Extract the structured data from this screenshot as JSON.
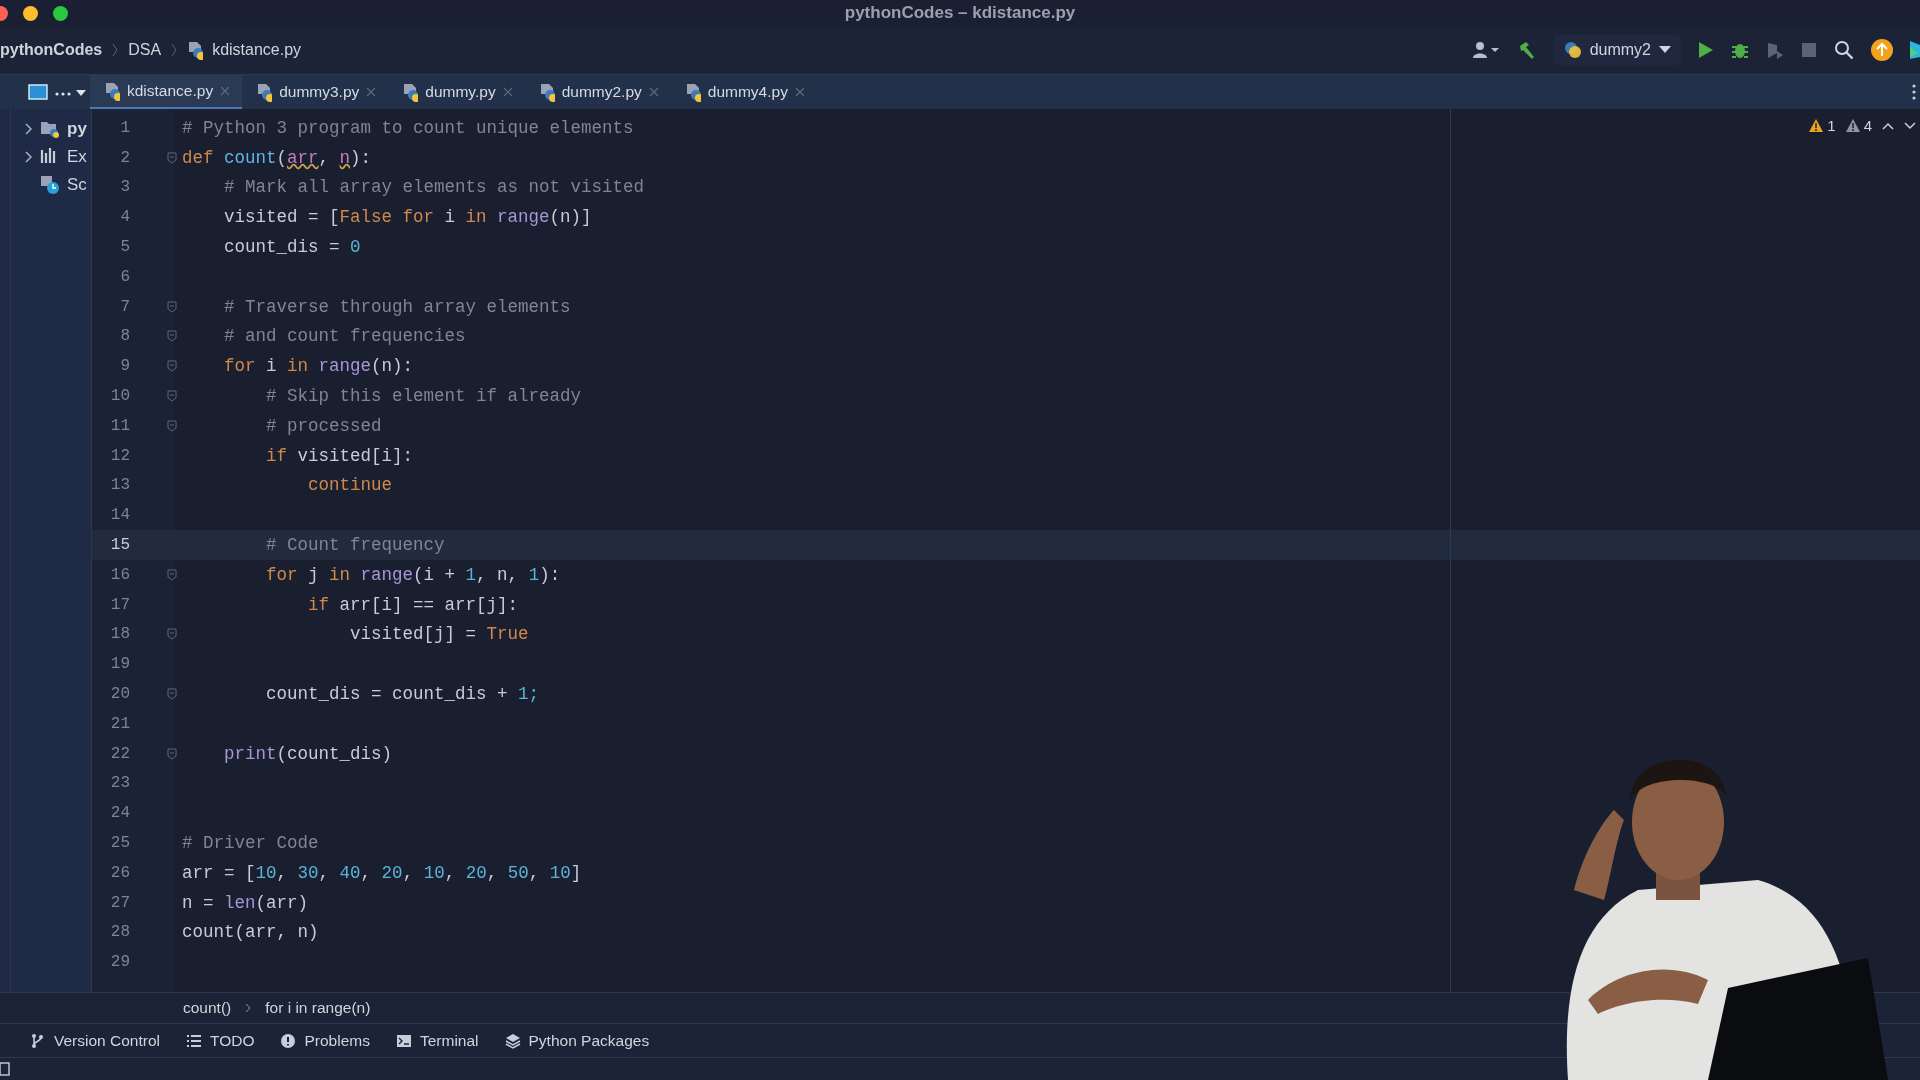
{
  "window": {
    "title": "pythonCodes – kdistance.py"
  },
  "navbar": {
    "crumbs": [
      "pythonCodes",
      "DSA",
      "kdistance.py"
    ],
    "run_config": "dummy2"
  },
  "tabs": [
    {
      "label": "kdistance.py",
      "selected": true
    },
    {
      "label": "dummy3.py",
      "selected": false
    },
    {
      "label": "dummy.py",
      "selected": false
    },
    {
      "label": "dummy2.py",
      "selected": false
    },
    {
      "label": "dummy4.py",
      "selected": false
    }
  ],
  "project_tree": [
    {
      "label": "py",
      "kind": "folder",
      "expanded": false
    },
    {
      "label": "Ex",
      "kind": "libs",
      "expanded": false
    },
    {
      "label": "Sc",
      "kind": "scratch"
    }
  ],
  "inspections": {
    "errors": "1",
    "warnings": "4"
  },
  "code": [
    {
      "n": "1",
      "fold": false,
      "current": false,
      "tokens": [
        {
          "kind": "cmt",
          "text": "# Python 3 program to count unique elements"
        }
      ]
    },
    {
      "n": "2",
      "fold": true,
      "current": false,
      "tokens": [
        {
          "kind": "kw",
          "text": "def "
        },
        {
          "kind": "fn",
          "text": "count"
        },
        {
          "kind": "p",
          "text": "("
        },
        {
          "kind": "warn",
          "text": "arr"
        },
        {
          "kind": "p",
          "text": ", "
        },
        {
          "kind": "warn",
          "text": "n"
        },
        {
          "kind": "p",
          "text": "):"
        }
      ]
    },
    {
      "n": "3",
      "fold": false,
      "current": false,
      "tokens": [
        {
          "kind": "cmt",
          "text": "    # Mark all array elements as not visited"
        }
      ]
    },
    {
      "n": "4",
      "fold": false,
      "current": false,
      "tokens": [
        {
          "kind": "p",
          "text": "    visited = ["
        },
        {
          "kind": "kw",
          "text": "False for "
        },
        {
          "kind": "p",
          "text": "i "
        },
        {
          "kind": "kw",
          "text": "in "
        },
        {
          "kind": "bi",
          "text": "range"
        },
        {
          "kind": "p",
          "text": "(n)]"
        }
      ]
    },
    {
      "n": "5",
      "fold": false,
      "current": false,
      "tokens": [
        {
          "kind": "p",
          "text": "    count_dis = "
        },
        {
          "kind": "num",
          "text": "0"
        }
      ]
    },
    {
      "n": "6",
      "fold": false,
      "current": false
    },
    {
      "n": "7",
      "fold": true,
      "current": false,
      "tokens": [
        {
          "kind": "cmt",
          "text": "    # Traverse through array elements"
        }
      ]
    },
    {
      "n": "8",
      "fold": true,
      "current": false,
      "tokens": [
        {
          "kind": "cmt",
          "text": "    # and count frequencies"
        }
      ]
    },
    {
      "n": "9",
      "fold": true,
      "current": false,
      "tokens": [
        {
          "kind": "kw",
          "text": "    for "
        },
        {
          "kind": "p",
          "text": "i "
        },
        {
          "kind": "kw",
          "text": "in "
        },
        {
          "kind": "bi",
          "text": "range"
        },
        {
          "kind": "p",
          "text": "(n):"
        }
      ]
    },
    {
      "n": "10",
      "fold": true,
      "current": false,
      "tokens": [
        {
          "kind": "cmt",
          "text": "        # Skip this element if already"
        }
      ]
    },
    {
      "n": "11",
      "fold": true,
      "current": false,
      "tokens": [
        {
          "kind": "cmt",
          "text": "        # processed"
        }
      ]
    },
    {
      "n": "12",
      "fold": false,
      "current": false,
      "tokens": [
        {
          "kind": "kw",
          "text": "        if "
        },
        {
          "kind": "p",
          "text": "visited[i]:"
        }
      ]
    },
    {
      "n": "13",
      "fold": false,
      "current": false,
      "tokens": [
        {
          "kind": "kw",
          "text": "            continue"
        }
      ]
    },
    {
      "n": "14",
      "fold": false,
      "current": false
    },
    {
      "n": "15",
      "fold": false,
      "current": true,
      "tokens": [
        {
          "kind": "cmt",
          "text": "        # Count frequency"
        }
      ]
    },
    {
      "n": "16",
      "fold": true,
      "current": false,
      "tokens": [
        {
          "kind": "kw",
          "text": "        for "
        },
        {
          "kind": "p",
          "text": "j "
        },
        {
          "kind": "kw",
          "text": "in "
        },
        {
          "kind": "bi",
          "text": "range"
        },
        {
          "kind": "p",
          "text": "(i + "
        },
        {
          "kind": "num",
          "text": "1"
        },
        {
          "kind": "p",
          "text": ", n, "
        },
        {
          "kind": "num",
          "text": "1"
        },
        {
          "kind": "p",
          "text": "):"
        }
      ]
    },
    {
      "n": "17",
      "fold": false,
      "current": false,
      "tokens": [
        {
          "kind": "kw",
          "text": "            if "
        },
        {
          "kind": "p",
          "text": "arr[i] == arr[j]:"
        }
      ]
    },
    {
      "n": "18",
      "fold": true,
      "current": false,
      "tokens": [
        {
          "kind": "p",
          "text": "                visited[j] = "
        },
        {
          "kind": "kw",
          "text": "True"
        }
      ]
    },
    {
      "n": "19",
      "fold": false,
      "current": false
    },
    {
      "n": "20",
      "fold": true,
      "current": false,
      "tokens": [
        {
          "kind": "p",
          "text": "        count_dis = count_dis + "
        },
        {
          "kind": "num",
          "text": "1;"
        }
      ]
    },
    {
      "n": "21",
      "fold": false,
      "current": false
    },
    {
      "n": "22",
      "fold": true,
      "current": false,
      "tokens": [
        {
          "kind": "bi",
          "text": "    print"
        },
        {
          "kind": "p",
          "text": "(count_dis)"
        }
      ]
    },
    {
      "n": "23",
      "fold": false,
      "current": false
    },
    {
      "n": "24",
      "fold": false,
      "current": false
    },
    {
      "n": "25",
      "fold": false,
      "current": false,
      "tokens": [
        {
          "kind": "cmt",
          "text": "# Driver Code"
        }
      ]
    },
    {
      "n": "26",
      "fold": false,
      "current": false,
      "tokens": [
        {
          "kind": "p",
          "text": "arr = ["
        },
        {
          "kind": "num",
          "text": "10"
        },
        {
          "kind": "p",
          "text": ", "
        },
        {
          "kind": "num",
          "text": "30"
        },
        {
          "kind": "p",
          "text": ", "
        },
        {
          "kind": "num",
          "text": "40"
        },
        {
          "kind": "p",
          "text": ", "
        },
        {
          "kind": "num",
          "text": "20"
        },
        {
          "kind": "p",
          "text": ", "
        },
        {
          "kind": "num",
          "text": "10"
        },
        {
          "kind": "p",
          "text": ", "
        },
        {
          "kind": "num",
          "text": "20"
        },
        {
          "kind": "p",
          "text": ", "
        },
        {
          "kind": "num",
          "text": "50"
        },
        {
          "kind": "p",
          "text": ", "
        },
        {
          "kind": "num",
          "text": "10"
        },
        {
          "kind": "p",
          "text": "]"
        }
      ]
    },
    {
      "n": "27",
      "fold": false,
      "current": false,
      "tokens": [
        {
          "kind": "p",
          "text": "n = "
        },
        {
          "kind": "bi",
          "text": "len"
        },
        {
          "kind": "p",
          "text": "(arr)"
        }
      ]
    },
    {
      "n": "28",
      "fold": false,
      "current": false,
      "tokens": [
        {
          "kind": "p",
          "text": "count(arr, n)"
        }
      ]
    },
    {
      "n": "29",
      "fold": false,
      "current": false
    }
  ],
  "code_breadcrumbs": [
    "count()",
    "for i in range(n)"
  ],
  "tool_windows": [
    {
      "label": "Version Control",
      "kind": "vcs"
    },
    {
      "label": "TODO",
      "kind": "todo"
    },
    {
      "label": "Problems",
      "kind": "problems"
    },
    {
      "label": "Terminal",
      "kind": "terminal"
    },
    {
      "label": "Python Packages",
      "kind": "packages"
    }
  ],
  "overlay": {
    "kind": "picture"
  }
}
